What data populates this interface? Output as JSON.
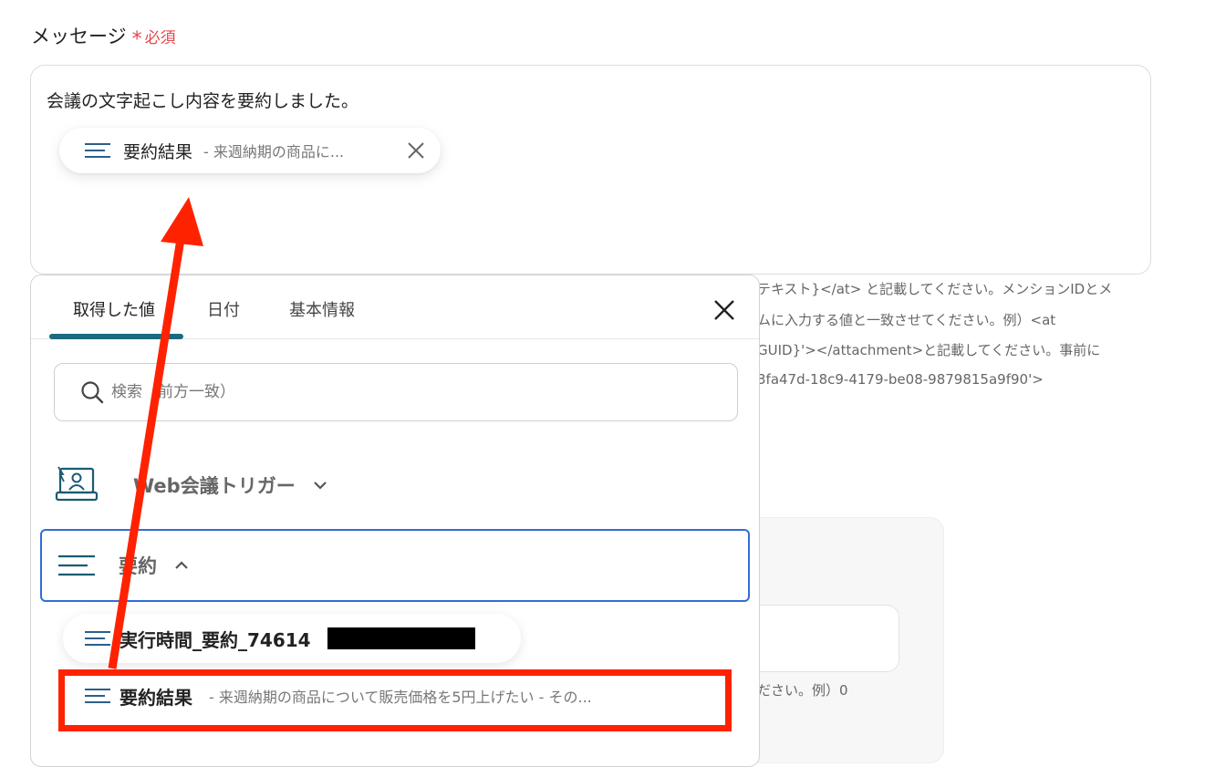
{
  "field": {
    "label": "メッセージ",
    "required_mark": "*",
    "required_text": "必須"
  },
  "message": {
    "text": "会議の文字起こし内容を要約しました。",
    "chip": {
      "title": "要約結果",
      "value": "- 来週納期の商品に..."
    }
  },
  "background_help": {
    "lines": [
      "テキスト}</at> と記載してください。メンションIDとメ",
      "ムに入力する値と一致させてください。例）<at",
      "GUID}'></attachment>と記載してください。事前に",
      "3fa47d-18c9-4179-be08-9879815a9f90'>"
    ],
    "line2": "ださい。例）0"
  },
  "panel": {
    "tabs": [
      {
        "label": "取得した値"
      },
      {
        "label": "日付"
      },
      {
        "label": "基本情報"
      }
    ],
    "search": {
      "placeholder": "検索（前方一致）"
    },
    "groups": {
      "web": {
        "label": "Web会議トリガー"
      },
      "summary": {
        "label": "要約"
      }
    },
    "items": {
      "exec": {
        "title": "実行時間_要約_74614"
      },
      "result": {
        "title": "要約結果",
        "value": "- 来週納期の商品について販売価格を5円上げたい - その..."
      }
    }
  },
  "colors": {
    "accent": "#1b6a7f",
    "required": "#e5484d",
    "highlight": "#ff2200",
    "focus_border": "#2f6fd3"
  }
}
